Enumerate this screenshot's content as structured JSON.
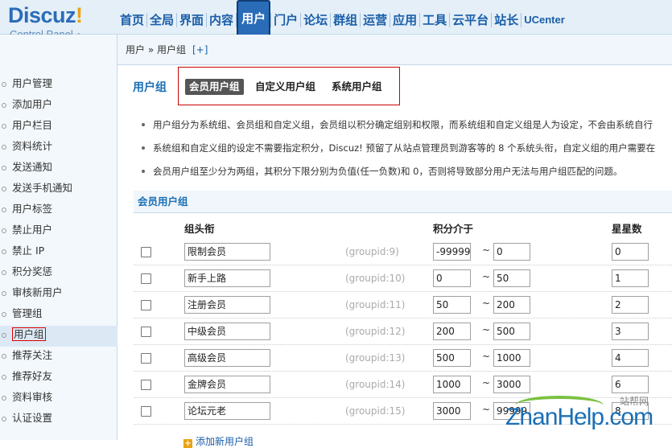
{
  "logo": {
    "brand_a": "Discuz",
    "brand_b": "!",
    "sub": "Control Panel"
  },
  "nav": [
    "首页",
    "全局",
    "界面",
    "内容",
    "用户",
    "门户",
    "论坛",
    "群组",
    "运营",
    "应用",
    "工具",
    "云平台",
    "站长",
    "UCenter"
  ],
  "nav_active": "用户",
  "breadcrumb": {
    "path": "用户 » 用户组",
    "add": "[+]"
  },
  "sidebar": [
    "用户管理",
    "添加用户",
    "用户栏目",
    "资料统计",
    "发送通知",
    "发送手机通知",
    "用户标签",
    "禁止用户",
    "禁止 IP",
    "积分奖惩",
    "审核新用户",
    "管理组",
    "用户组",
    "推荐关注",
    "推荐好友",
    "资料审核",
    "认证设置"
  ],
  "sidebar_active": "用户组",
  "page": {
    "title": "用户组",
    "tabs": [
      "会员用户组",
      "自定义用户组",
      "系统用户组"
    ],
    "tab_active": "会员用户组"
  },
  "tips": [
    "用户组分为系统组、会员组和自定义组，会员组以积分确定组别和权限，而系统组和自定义组是人为设定，不会由系统自行",
    "系统组和自定义组的设定不需要指定积分，Discuz! 预留了从站点管理员到游客等的 8 个系统头衔，自定义组的用户需要在",
    "会员用户组至少分为两组，其积分下限分别为负值(任一负数)和 0，否则将导致部分用户无法与用户组匹配的问题。"
  ],
  "section": {
    "title": "会员用户组"
  },
  "columns": {
    "name": "组头衔",
    "credits": "积分介于",
    "stars": "星星数"
  },
  "rows": [
    {
      "name": "限制会员",
      "gid": "(groupid:9)",
      "low": "-99999",
      "high": "0",
      "stars": "0"
    },
    {
      "name": "新手上路",
      "gid": "(groupid:10)",
      "low": "0",
      "high": "50",
      "stars": "1"
    },
    {
      "name": "注册会员",
      "gid": "(groupid:11)",
      "low": "50",
      "high": "200",
      "stars": "2"
    },
    {
      "name": "中级会员",
      "gid": "(groupid:12)",
      "low": "200",
      "high": "500",
      "stars": "3"
    },
    {
      "name": "高级会员",
      "gid": "(groupid:13)",
      "low": "500",
      "high": "1000",
      "stars": "4"
    },
    {
      "name": "金牌会员",
      "gid": "(groupid:14)",
      "low": "1000",
      "high": "3000",
      "stars": "6"
    },
    {
      "name": "论坛元老",
      "gid": "(groupid:15)",
      "low": "3000",
      "high": "99999",
      "stars": "8"
    }
  ],
  "tilde": "~",
  "add_link": "添加新用户组",
  "watermark": {
    "text": "ZhanHelp.com",
    "cn": "站帮网"
  }
}
